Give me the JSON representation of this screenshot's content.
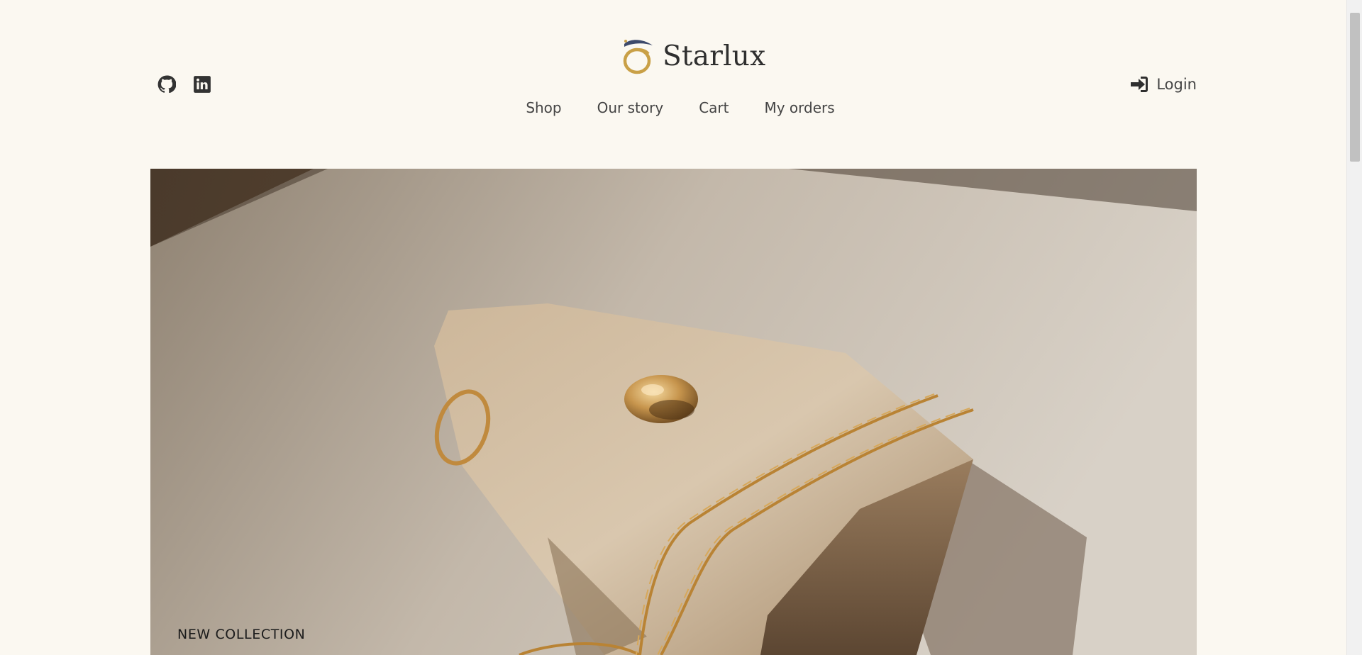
{
  "brand": {
    "name": "Starlux",
    "logo_icon": "ring-logo-icon"
  },
  "socials": [
    {
      "icon": "github-icon",
      "label": "GitHub"
    },
    {
      "icon": "linkedin-icon",
      "label": "LinkedIn"
    }
  ],
  "nav": {
    "items": [
      {
        "label": "Shop"
      },
      {
        "label": "Our story"
      },
      {
        "label": "Cart"
      },
      {
        "label": "My orders"
      }
    ]
  },
  "login": {
    "label": "Login",
    "icon": "sign-in-icon"
  },
  "hero": {
    "tag": "NEW COLLECTION",
    "image": "gold rings and chain on stone slab"
  },
  "colors": {
    "background": "#fbf8f1",
    "accent_gold": "#c9a047",
    "text": "#3a3a3a"
  }
}
